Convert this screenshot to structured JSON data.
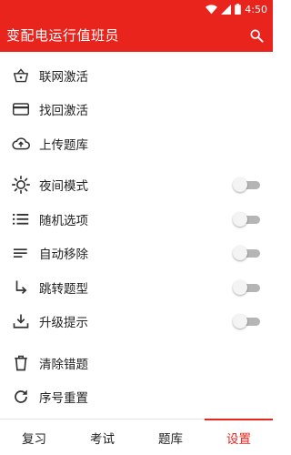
{
  "status_bar": {
    "time": "4:50",
    "icons": [
      "wifi-icon",
      "signal-icon",
      "battery-icon"
    ]
  },
  "app_bar": {
    "title": "变配电运行值班员",
    "search_icon": "search-icon",
    "color": "#e8241d"
  },
  "menu": {
    "group1": [
      {
        "label": "联网激活",
        "icon": "basket-icon"
      },
      {
        "label": "找回激活",
        "icon": "card-icon"
      },
      {
        "label": "上传题库",
        "icon": "cloud-upload-icon"
      }
    ],
    "group2": [
      {
        "label": "夜间模式",
        "icon": "sun-icon",
        "toggle": false
      },
      {
        "label": "随机选项",
        "icon": "list-icon",
        "toggle": false
      },
      {
        "label": "自动移除",
        "icon": "lines-icon",
        "toggle": false
      },
      {
        "label": "跳转题型",
        "icon": "subdirectory-arrow-icon",
        "toggle": false
      },
      {
        "label": "升级提示",
        "icon": "download-icon",
        "toggle": false
      }
    ],
    "group3": [
      {
        "label": "清除错题",
        "icon": "trash-icon"
      },
      {
        "label": "序号重置",
        "icon": "refresh-icon"
      }
    ]
  },
  "tabs": [
    {
      "label": "复习",
      "active": false
    },
    {
      "label": "考试",
      "active": false
    },
    {
      "label": "题库",
      "active": false
    },
    {
      "label": "设置",
      "active": true
    }
  ]
}
